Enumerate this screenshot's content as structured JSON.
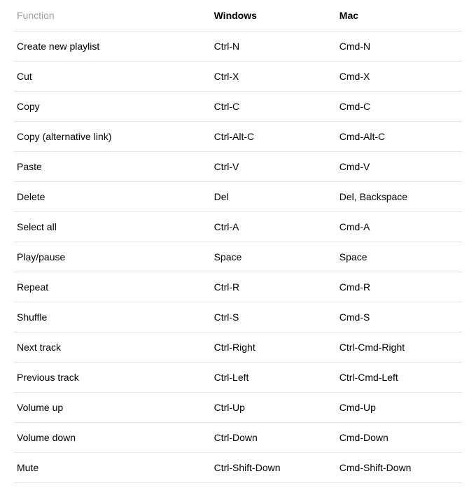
{
  "headers": {
    "function": "Function",
    "windows": "Windows",
    "mac": "Mac"
  },
  "rows": [
    {
      "function": "Create new playlist",
      "windows": "Ctrl-N",
      "mac": "Cmd-N"
    },
    {
      "function": "Cut",
      "windows": "Ctrl-X",
      "mac": "Cmd-X"
    },
    {
      "function": "Copy",
      "windows": "Ctrl-C",
      "mac": "Cmd-C"
    },
    {
      "function": "Copy (alternative link)",
      "windows": "Ctrl-Alt-C",
      "mac": "Cmd-Alt-C"
    },
    {
      "function": "Paste",
      "windows": "Ctrl-V",
      "mac": "Cmd-V"
    },
    {
      "function": "Delete",
      "windows": "Del",
      "mac": "Del, Backspace"
    },
    {
      "function": "Select all",
      "windows": "Ctrl-A",
      "mac": "Cmd-A"
    },
    {
      "function": "Play/pause",
      "windows": "Space",
      "mac": "Space"
    },
    {
      "function": "Repeat",
      "windows": "Ctrl-R",
      "mac": "Cmd-R"
    },
    {
      "function": "Shuffle",
      "windows": "Ctrl-S",
      "mac": "Cmd-S"
    },
    {
      "function": "Next track",
      "windows": "Ctrl-Right",
      "mac": "Ctrl-Cmd-Right"
    },
    {
      "function": "Previous track",
      "windows": "Ctrl-Left",
      "mac": "Ctrl-Cmd-Left"
    },
    {
      "function": "Volume up",
      "windows": "Ctrl-Up",
      "mac": "Cmd-Up"
    },
    {
      "function": "Volume down",
      "windows": "Ctrl-Down",
      "mac": "Cmd-Down"
    },
    {
      "function": "Mute",
      "windows": "Ctrl-Shift-Down",
      "mac": "Cmd-Shift-Down"
    }
  ]
}
